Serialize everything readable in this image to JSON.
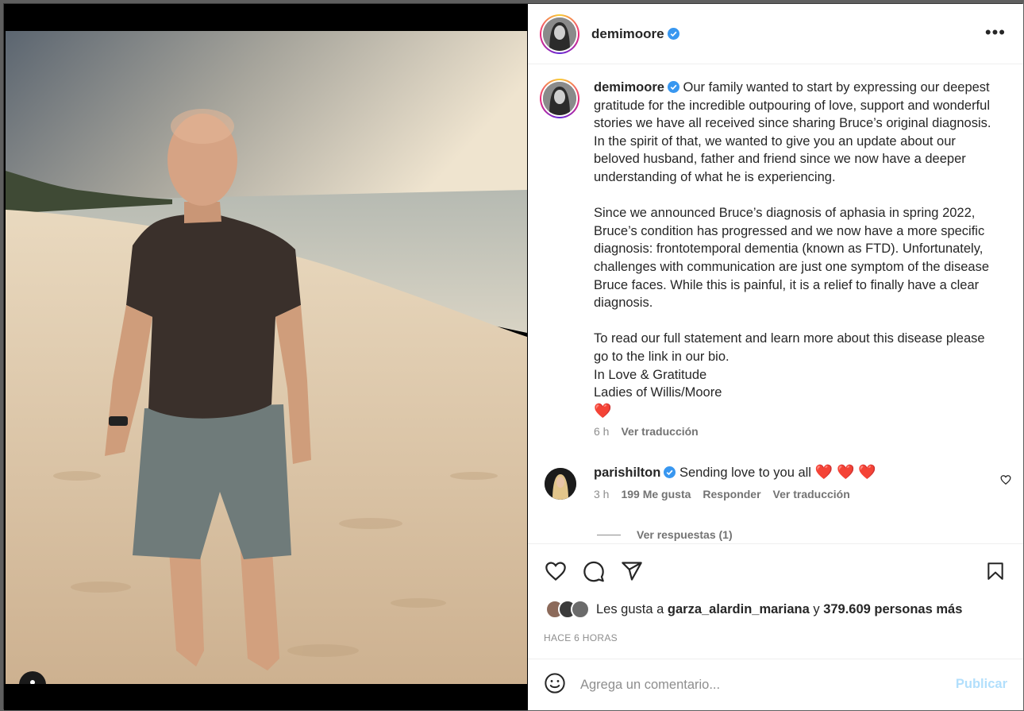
{
  "post": {
    "author": "demimoore",
    "more_icon": "more-horizontal-icon"
  },
  "caption": {
    "username": "demimoore",
    "paragraph1": "Our family wanted to start by expressing our deepest gratitude for the incredible outpouring of love, support and wonderful stories we have all received since sharing Bruce’s original diagnosis. In the spirit of that, we wanted to give you an update about our beloved husband, father and friend since we now have a deeper understanding of what he is experiencing.",
    "paragraph2": "Since we announced Bruce’s diagnosis of aphasia in spring 2022, Bruce’s condition has progressed and we now have a more specific diagnosis: frontotemporal dementia (known as FTD). Unfortunately, challenges with communication are just one symptom of the disease Bruce faces. While this is painful, it is a relief to finally have a clear diagnosis.",
    "paragraph3": "To read our full statement and learn more about this disease please go to the link in our bio.",
    "line4": "In Love & Gratitude",
    "line5": "Ladies of Willis/Moore",
    "emoji": "❤️",
    "time": "6 h",
    "translate": "Ver traducción"
  },
  "comment": {
    "username": "parishilton",
    "text": "Sending love to you all",
    "hearts": "❤️ ❤️ ❤️",
    "time": "3 h",
    "likes": "199 Me gusta",
    "reply": "Responder",
    "translate": "Ver traducción",
    "view_replies": "Ver respuestas (1)"
  },
  "likes": {
    "prefix": "Les gusta a",
    "user": "garza_alardin_mariana",
    "connector": "y",
    "others": "379.609 personas más"
  },
  "timestamp": "HACE 6 HORAS",
  "composer": {
    "placeholder": "Agrega un comentario...",
    "publish": "Publicar"
  },
  "colors": {
    "verified": "#3897f0",
    "heart": "#e11d2b",
    "publish_disabled": "#b2dffc"
  }
}
